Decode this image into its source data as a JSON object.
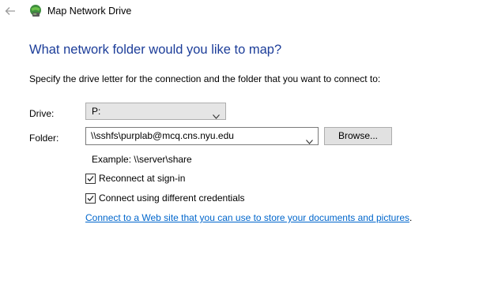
{
  "window": {
    "title": "Map Network Drive",
    "back_icon": "back-arrow-icon",
    "app_icon": "network-drive-icon"
  },
  "main": {
    "heading": "What network folder would you like to map?",
    "instructions": "Specify the drive letter for the connection and the folder that you want to connect to:",
    "drive": {
      "label": "Drive:",
      "value": "P:"
    },
    "folder": {
      "label": "Folder:",
      "value": "\\\\sshfs\\purplab@mcq.cns.nyu.edu",
      "browse_label": "Browse..."
    },
    "example": "Example: \\\\server\\share",
    "reconnect": {
      "label": "Reconnect at sign-in",
      "checked": true
    },
    "credentials": {
      "label": "Connect using different credentials",
      "checked": true
    },
    "link_text": "Connect to a Web site that you can use to store your documents and pictures",
    "link_suffix": "."
  },
  "colors": {
    "heading": "#1c3d99",
    "link": "#0066cc"
  }
}
